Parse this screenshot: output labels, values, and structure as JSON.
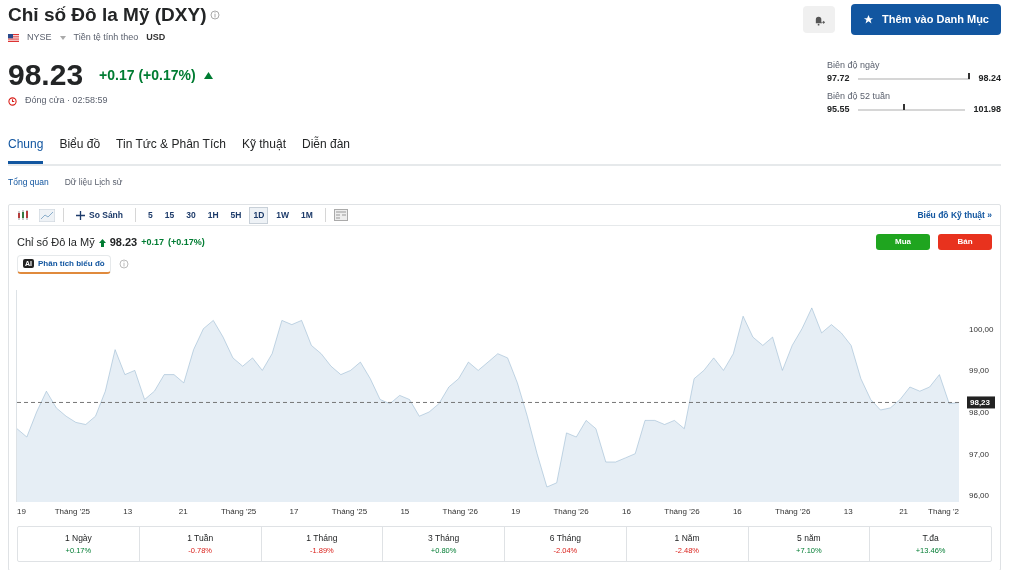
{
  "header": {
    "title": "Chỉ số Đô la Mỹ (DXY)",
    "exchange": "NYSE",
    "currency_label": "Tiền tệ tính theo",
    "currency": "USD",
    "price": "98.23",
    "change": "+0.17 (+0.17%)",
    "kind": "up",
    "status": "Đóng cửa · 02:58:59",
    "watchlist_button": "Thêm vào Danh Mục"
  },
  "ranges": [
    {
      "label": "Biên độ ngày",
      "low": "97.72",
      "high": "98.24",
      "level": 0.98
    },
    {
      "label": "Biên độ 52 tuần",
      "low": "95.55",
      "high": "101.98",
      "level": 0.42
    }
  ],
  "tabs": [
    {
      "label": "Chung",
      "selected": true
    },
    {
      "label": "Biểu đồ",
      "selected": false
    },
    {
      "label": "Tin Tức & Phân Tích",
      "selected": false
    },
    {
      "label": "Kỹ thuật",
      "selected": false
    },
    {
      "label": "Diễn đàn",
      "selected": false
    }
  ],
  "subtabs": [
    {
      "label": "Tổng quan",
      "selected": true
    },
    {
      "label": "Dữ liệu Lịch sử",
      "selected": false
    }
  ],
  "toolbar": {
    "compare": "So Sánh",
    "intervals": [
      {
        "label": "5",
        "selected": false
      },
      {
        "label": "15",
        "selected": false
      },
      {
        "label": "30",
        "selected": false
      },
      {
        "label": "1H",
        "selected": false
      },
      {
        "label": "5H",
        "selected": false
      },
      {
        "label": "1D",
        "selected": true
      },
      {
        "label": "1W",
        "selected": false
      },
      {
        "label": "1M",
        "selected": false
      }
    ],
    "link": "Biểu đồ Kỹ thuật »"
  },
  "quote": {
    "name": "Chỉ số Đô la Mỹ",
    "price": "98.23",
    "change": "+0.17",
    "percent": "(+0.17%)",
    "ai_badge": "AI",
    "ai_label": "Phân tích biểu đồ",
    "buy": "Mua",
    "sell": "Bán",
    "x_labels": [
      "19",
      "Tháng '25",
      "13",
      "21",
      "Tháng '25",
      "17",
      "Tháng '25",
      "15",
      "Tháng '26",
      "19",
      "Tháng '26",
      "16",
      "Tháng '26",
      "16",
      "Tháng '26",
      "13",
      "21",
      "Tháng '2"
    ]
  },
  "chart_data": {
    "type": "area",
    "ylim": [
      95.84,
      100.93
    ],
    "yticks": [
      {
        "value": 96,
        "label": "96,00"
      },
      {
        "value": 97,
        "label": "97,00"
      },
      {
        "value": 98,
        "label": "98,00"
      },
      {
        "value": 99,
        "label": "99,00"
      },
      {
        "value": 100,
        "label": "100,00"
      }
    ],
    "series": [
      {
        "color": "#8aaecb",
        "values": [
          97.6,
          97.4,
          98.0,
          98.5,
          98.1,
          97.9,
          97.75,
          97.7,
          97.9,
          98.5,
          99.5,
          98.9,
          99.0,
          98.3,
          98.5,
          98.9,
          98.9,
          98.7,
          99.5,
          100.0,
          100.2,
          99.8,
          99.3,
          99.1,
          99.3,
          99.0,
          99.4,
          100.2,
          100.1,
          100.2,
          99.6,
          99.4,
          99.1,
          98.9,
          99.0,
          99.2,
          98.8,
          98.3,
          98.2,
          98.4,
          98.3,
          97.9,
          98.0,
          98.2,
          98.6,
          98.8,
          99.2,
          99.0,
          99.2,
          99.4,
          99.3,
          98.7,
          97.9,
          97.0,
          96.2,
          96.3,
          97.5,
          97.4,
          97.8,
          97.6,
          96.8,
          96.8,
          96.9,
          97.0,
          97.8,
          97.8,
          97.7,
          97.8,
          97.6,
          98.8,
          99.0,
          99.3,
          99.0,
          99.4,
          100.3,
          99.8,
          99.6,
          99.8,
          99.0,
          99.6,
          100.0,
          100.5,
          99.9,
          100.1,
          99.9,
          99.6,
          98.8,
          98.3,
          98.05,
          98.1,
          98.3,
          98.6,
          98.5,
          98.6,
          98.9,
          98.2,
          98.23
        ]
      }
    ],
    "ref_lines": [
      {
        "axis": "y",
        "value": 98.23,
        "label": "98,23"
      }
    ]
  },
  "performance": [
    {
      "period": "1 Ngày",
      "change": "+0.17%",
      "kind": "up"
    },
    {
      "period": "1 Tuần",
      "change": "-0.78%",
      "kind": "down"
    },
    {
      "period": "1 Tháng",
      "change": "-1.89%",
      "kind": "down"
    },
    {
      "period": "3 Tháng",
      "change": "+0.80%",
      "kind": "up"
    },
    {
      "period": "6 Tháng",
      "change": "-2.04%",
      "kind": "down"
    },
    {
      "period": "1 Năm",
      "change": "-2.48%",
      "kind": "down"
    },
    {
      "period": "5 năm",
      "change": "+7.10%",
      "kind": "up"
    },
    {
      "period": "T.đa",
      "change": "+13.46%",
      "kind": "up"
    }
  ]
}
